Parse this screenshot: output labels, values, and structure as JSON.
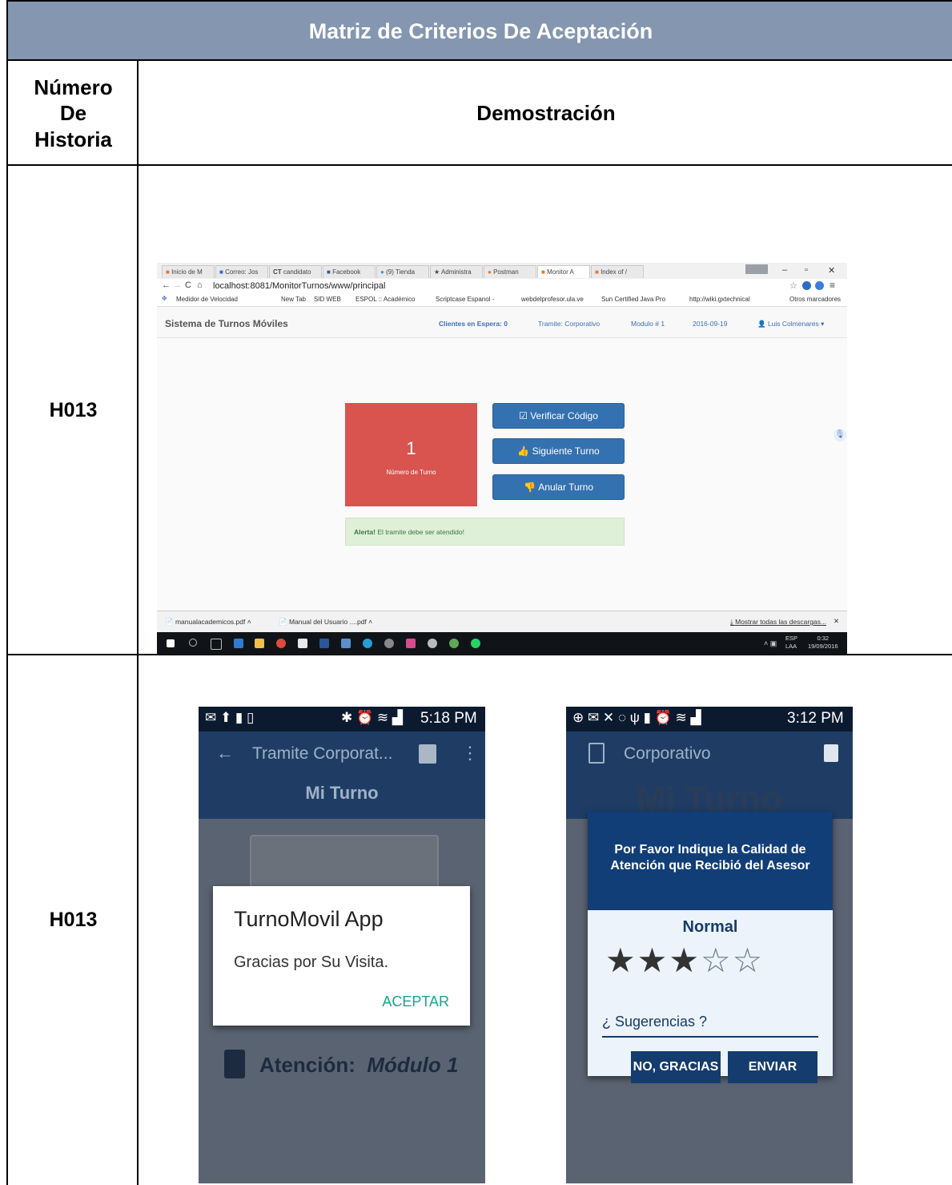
{
  "table": {
    "title": "Matriz de Criterios De Aceptación",
    "col_number": "Número De Historia",
    "col_demo": "Demostración",
    "rows": [
      {
        "id": "H013"
      },
      {
        "id": "H013"
      }
    ]
  },
  "browser": {
    "tabs": [
      "Inicio de M",
      "Correo: Jos",
      "candidato",
      "Facebook",
      "(9) Tienda",
      "Administra",
      "Postman",
      "Monitor A",
      "Index of /"
    ],
    "url": "localhost:8081/MonitorTurnos/www/principal",
    "bookmarks": [
      "Medidor de Velocidad",
      "New Tab",
      "SID WEB",
      "ESPOL :: Académico",
      "Scriptcase Espanol -",
      "webdelprofesor.ula.ve",
      "Sun Certified Java Pro",
      "http://wiki.gxtechnical",
      "Otros marcadores"
    ],
    "app_title": "Sistema de Turnos Móviles",
    "nav_clients": "Clientes en Espera: 0",
    "nav_tramite": "Tramite: Corporativo",
    "nav_modulo": "Modulo # 1",
    "nav_date": "2016-09-19",
    "nav_user": "Luis Colmenares",
    "turn_number": "1",
    "turn_label": "Número de Turno",
    "btn_verify": "Verificar Código",
    "btn_next": "Siguiente Turno",
    "btn_cancel": "Anular Turno",
    "alert_strong": "Alerta!",
    "alert_text": "El tramite debe ser atendido!",
    "downloads": [
      "manualacademicos.pdf",
      "Manual del Usuario ....pdf"
    ],
    "show_downloads": "Mostrar todas las descargas...",
    "tray_lang": "ESP",
    "tray_lang2": "LAA",
    "tray_time": "0:32",
    "tray_date": "19/09/2016"
  },
  "phone1": {
    "time": "5:18 PM",
    "title": "Tramite Corporat...",
    "subtitle": "Mi Turno",
    "dialog_title": "TurnoMovil App",
    "dialog_message": "Gracias por Su Visita.",
    "dialog_button": "ACEPTAR",
    "attention_label": "Atención:",
    "attention_value": "Módulo 1"
  },
  "phone2": {
    "time": "3:12 PM",
    "title": "Corporativo",
    "bg_title": "Mi Turno",
    "dialog_header": "Por Favor Indique la Calidad de Atención que Recibió del Asesor",
    "rating_label": "Normal",
    "rating": 3,
    "rating_max": 5,
    "suggest_placeholder": "¿ Sugerencias ?",
    "btn_no": "NO, GRACIAS",
    "btn_send": "ENVIAR"
  },
  "colors": {
    "header_bg": "#8496b0",
    "turn_red": "#d9534f",
    "btn_blue": "#3471b0",
    "phone_navy": "#163b6a",
    "teal": "#1aa38f"
  }
}
